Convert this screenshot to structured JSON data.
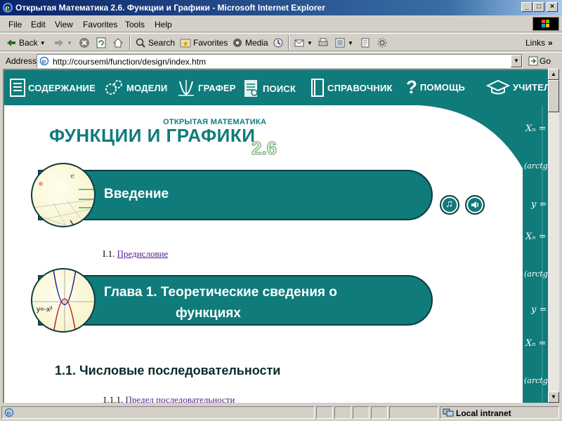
{
  "window": {
    "title": "Открытая Математика 2.6. Функции и Графики - Microsoft Internet Explorer"
  },
  "menu": [
    "File",
    "Edit",
    "View",
    "Favorites",
    "Tools",
    "Help"
  ],
  "toolbar": {
    "back": "Back",
    "search": "Search",
    "favorites": "Favorites",
    "media": "Media",
    "links": "Links"
  },
  "address": {
    "label": "Address",
    "url": "http://courseml/function/design/index.htm",
    "go": "Go"
  },
  "nav": {
    "items": [
      "СОДЕРЖАНИЕ",
      "МОДЕЛИ",
      "ГРАФЕР",
      "ПОИСК",
      "СПРАВОЧНИК",
      "ПОМОЩЬ",
      "УЧИТЕЛ"
    ]
  },
  "logo": {
    "subtitle": "ОТКРЫТАЯ МАТЕМАТИКА",
    "title": "ФУНКЦИИ И ГРАФИКИ",
    "version": "2.6"
  },
  "content": {
    "banner1": "Введение",
    "link1_num": "I.1.",
    "link1_text": "Предисловие",
    "banner2_line1": "Глава 1. Теоретические сведения о",
    "banner2_line2": "функциях",
    "graph_label": "y=-x²",
    "section": "1.1. Числовые последовательности",
    "link2_num": "1.1.1.",
    "link2_text": "Предел последовательности"
  },
  "formulas": [
    "Xₙ =",
    "(arctg x",
    "y =",
    "Xₙ =",
    "(arctg x",
    "y =",
    "Xₙ =",
    "(arctg x"
  ],
  "status": {
    "zone": "Local intranet"
  },
  "colors": {
    "teal": "#0f7b7a",
    "title_blue": "#0a246a",
    "link_visited": "#551a8b"
  }
}
